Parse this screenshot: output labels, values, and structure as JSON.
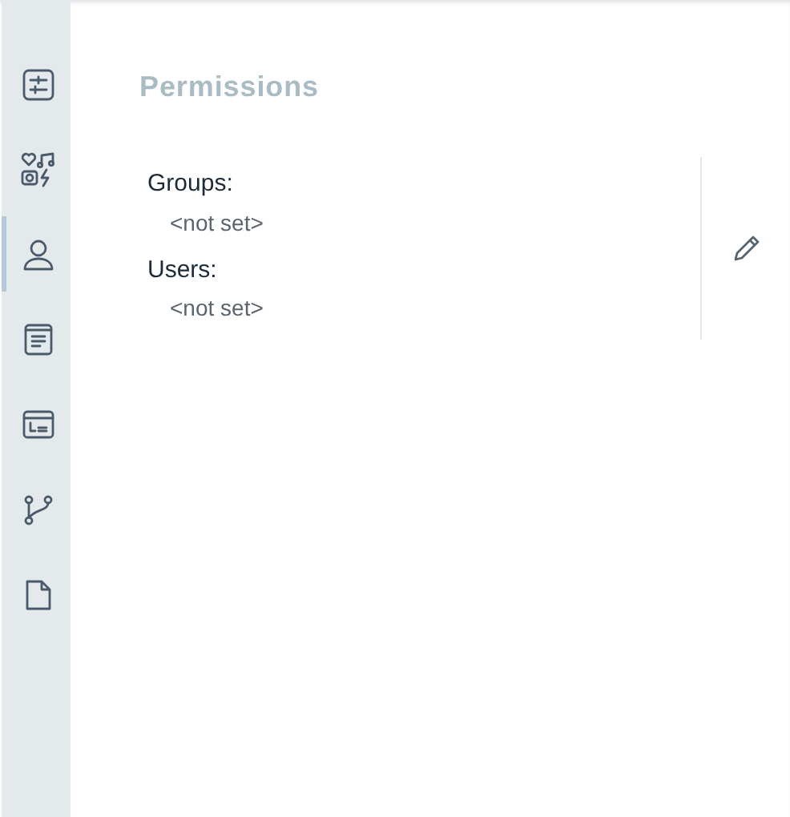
{
  "sidebar": {
    "items": [
      {
        "kind": "sliders",
        "selected": false
      },
      {
        "kind": "media",
        "selected": false
      },
      {
        "kind": "user",
        "selected": true
      },
      {
        "kind": "document",
        "selected": false
      },
      {
        "kind": "panel",
        "selected": false
      },
      {
        "kind": "branch",
        "selected": false
      },
      {
        "kind": "file",
        "selected": false
      }
    ]
  },
  "title": "Permissions",
  "fields": [
    {
      "label": "Groups:",
      "value": "<not set>"
    },
    {
      "label": "Users:",
      "value": "<not set>"
    }
  ]
}
